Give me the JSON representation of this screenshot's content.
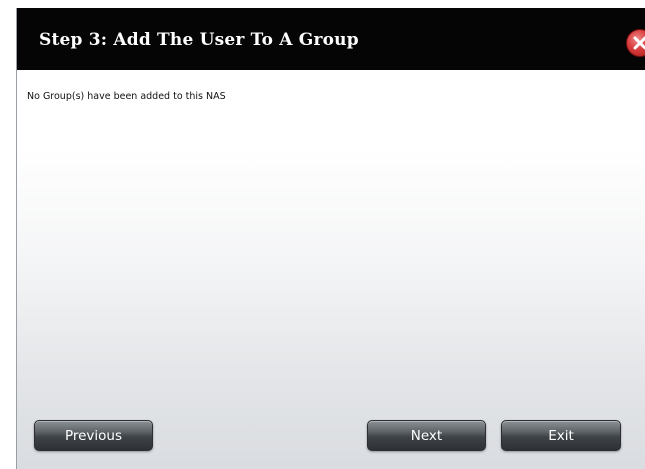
{
  "dialog": {
    "title": "Step 3: Add The User To A Group",
    "message": "No Group(s) have been added to this NAS"
  },
  "buttons": {
    "previous_label": "Previous",
    "next_label": "Next",
    "exit_label": "Exit"
  },
  "icons": {
    "close": "close-icon"
  },
  "colors": {
    "titlebar": "#050505",
    "title_text": "#ffffff",
    "close_button": "#d83b3b",
    "button": "#4a4f54"
  }
}
